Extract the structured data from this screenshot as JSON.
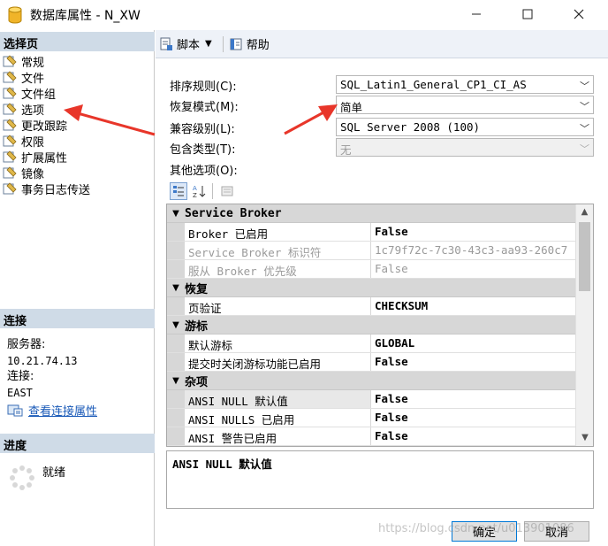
{
  "window": {
    "title": "数据库属性 - N_XW"
  },
  "left": {
    "select_page_heading": "选择页",
    "pages": [
      {
        "label": "常规",
        "icon": "page-icon"
      },
      {
        "label": "文件",
        "icon": "page-icon"
      },
      {
        "label": "文件组",
        "icon": "page-icon"
      },
      {
        "label": "选项",
        "icon": "page-icon"
      },
      {
        "label": "更改跟踪",
        "icon": "page-icon"
      },
      {
        "label": "权限",
        "icon": "page-icon"
      },
      {
        "label": "扩展属性",
        "icon": "page-icon"
      },
      {
        "label": "镜像",
        "icon": "page-icon"
      },
      {
        "label": "事务日志传送",
        "icon": "page-icon"
      }
    ],
    "connection_heading": "连接",
    "server_label": "服务器:",
    "server_value": "10.21.74.13",
    "connection_label": "连接:",
    "connection_value": "EAST",
    "view_link": "查看连接属性",
    "progress_heading": "进度",
    "progress_status": "就绪"
  },
  "toolbar": {
    "script_label": "脚本",
    "help_label": "帮助"
  },
  "form": {
    "collation_label": "排序规则(C):",
    "collation_value": "SQL_Latin1_General_CP1_CI_AS",
    "recovery_label": "恢复模式(M):",
    "recovery_value": "简单",
    "compat_label": "兼容级别(L):",
    "compat_value": "SQL Server 2008 (100)",
    "containment_label": "包含类型(T):",
    "containment_value": "无",
    "other_label": "其他选项(O):"
  },
  "grid": {
    "cat_service_broker": "Service Broker",
    "broker_enabled_name": "Broker 已启用",
    "broker_enabled_value": "False",
    "broker_id_name": "Service Broker 标识符",
    "broker_id_value": "1c79f72c-7c30-43c3-aa93-260c7",
    "broker_priority_name": "服从 Broker 优先级",
    "broker_priority_value": "False",
    "cat_recovery": "恢复",
    "page_verify_name": "页验证",
    "page_verify_value": "CHECKSUM",
    "cat_cursor": "游标",
    "default_cursor_name": "默认游标",
    "default_cursor_value": "GLOBAL",
    "close_cursor_name": "提交时关闭游标功能已启用",
    "close_cursor_value": "False",
    "cat_misc": "杂项",
    "ansi_null_default_name": "ANSI NULL 默认值",
    "ansi_null_default_value": "False",
    "ansi_nulls_name": "ANSI NULLS 已启用",
    "ansi_nulls_value": "False",
    "ansi_warnings_name": "ANSI 警告已启用",
    "ansi_warnings_value": "False"
  },
  "description": {
    "text": "ANSI NULL 默认值"
  },
  "buttons": {
    "ok": "确定",
    "cancel": "取消"
  },
  "watermark": "https://blog.csdn.net/u013901086",
  "colors": {
    "arrow": "#e8362a",
    "section_header": "#cfdbe7",
    "category_band": "#d7d7d7"
  }
}
